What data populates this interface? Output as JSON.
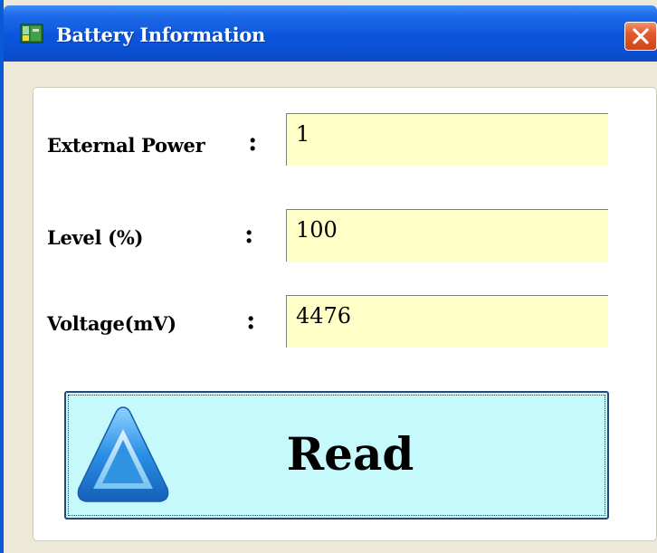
{
  "window": {
    "title": "Battery Information",
    "icons": {
      "app": "battery-app-icon",
      "close": "close-icon"
    }
  },
  "fields": [
    {
      "label": "External Power",
      "colon": ":",
      "value": "1"
    },
    {
      "label": "Level (%)",
      "colon": ":",
      "value": "100"
    },
    {
      "label": "Voltage(mV)",
      "colon": ":",
      "value": "4476"
    }
  ],
  "read_button": {
    "label": "Read",
    "icon": "up-arrow-icon"
  },
  "colors": {
    "field_background": "#ffffc8",
    "button_background": "#c5f9fb",
    "titlebar": "#0b55dc"
  }
}
